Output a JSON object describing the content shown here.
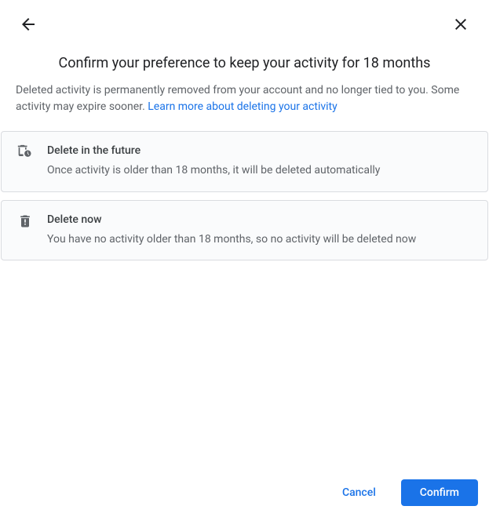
{
  "header": {
    "title": "Confirm your preference to keep your activity for 18 months"
  },
  "description": {
    "text": "Deleted activity is permanently removed from your account and no longer tied to you. Some activity may expire sooner. ",
    "link": "Learn more about deleting your activity"
  },
  "cards": {
    "future": {
      "title": "Delete in the future",
      "desc": "Once activity is older than 18 months, it will be deleted automatically"
    },
    "now": {
      "title": "Delete now",
      "desc": "You have no activity older than 18 months, so no activity will be deleted now"
    }
  },
  "footer": {
    "cancel": "Cancel",
    "confirm": "Confirm"
  }
}
